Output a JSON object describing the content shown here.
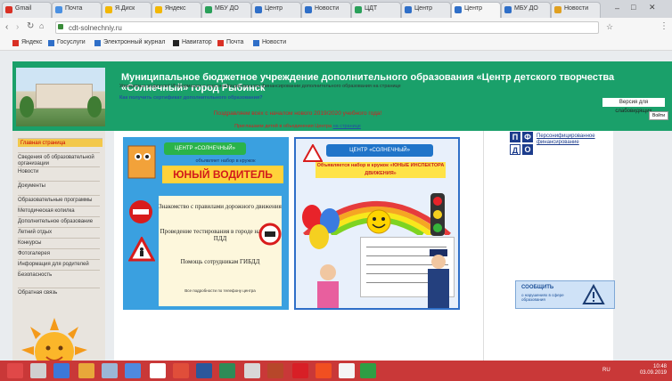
{
  "browser": {
    "tabs": [
      {
        "label": "Gmail",
        "color": "#d93025"
      },
      {
        "label": "Почта",
        "color": "#4a90e2"
      },
      {
        "label": "Я.Диск",
        "color": "#f2b705"
      },
      {
        "label": "Яндекс",
        "color": "#f2b705"
      },
      {
        "label": "МБУ ДО",
        "color": "#2aa05a"
      },
      {
        "label": "Центр",
        "color": "#2f6fc8"
      },
      {
        "label": "Новости",
        "color": "#2f6fc8"
      },
      {
        "label": "ЦДТ",
        "color": "#2aa05a"
      },
      {
        "label": "Центр",
        "color": "#2f6fc8"
      },
      {
        "label": "Центр",
        "color": "#2f6fc8"
      },
      {
        "label": "МБУ ДО",
        "color": "#2f6fc8"
      },
      {
        "label": "Новости",
        "color": "#e0a020"
      }
    ],
    "active_tab": 9,
    "url": "cdt-solnechniy.ru",
    "bookmarks": [
      {
        "label": "Яндекс",
        "color": "#d93025"
      },
      {
        "label": "Госуслуги",
        "color": "#2f6fc8"
      },
      {
        "label": "Электронный журнал",
        "color": "#2f6fc8"
      },
      {
        "label": "Навигатор",
        "color": "#222222"
      },
      {
        "label": "Почта",
        "color": "#d93025"
      },
      {
        "label": "Новости",
        "color": "#2f6fc8"
      }
    ]
  },
  "header": {
    "title_line1": "Муниципальное бюджетное учреждение дополнительного образования «Центр детского творчества",
    "title_line2": "«Солнечный» город Рыбинск",
    "version_button": "Версия для слабовидящих",
    "enter_button": "Войти"
  },
  "sidebar": {
    "items": [
      "Главная страница",
      "Сведения об образовательной организации",
      "Новости",
      "Документы",
      "Образовательные программы",
      "Методическая копилка",
      "Дополнительное образование",
      "Летний отдых",
      "Конкурсы",
      "Фотогалерея",
      "Информация для родителей",
      "Безопасность",
      "Обратная связь"
    ]
  },
  "content": {
    "notice1": "Уважаемые родители! Информация о персонифицированном финансировании дополнительного образования на странице",
    "notice1_link": "на странице",
    "notice2": "Как получить сертификат дополнительного образования?",
    "congrats": "Поздравляем всех с началом нового 2019/2020 учебного года!",
    "subcongrats": "Приглашаем детей в объединения Центра",
    "subcongrats_link": "на странице"
  },
  "poster1": {
    "head": "ЦЕНТР «СОЛНЕЧНЫЙ»",
    "sub": "объявляет набор в кружок",
    "title": "ЮНЫЙ ВОДИТЕЛЬ",
    "text1": "Знакомство с правилами дорожного движения",
    "text2": "Проведение тестирования в городе на знание ПДД",
    "text3": "Помощь сотрудникам ГИБДД",
    "small": "Все подробности по телефону центра"
  },
  "poster2": {
    "head": "ЦЕНТР «СОЛНЕЧНЫЙ»",
    "title": "Объявляется набор в кружок «ЮНЫЕ ИНСПЕКТОРА ДВИЖЕНИЯ»"
  },
  "right": {
    "note_title": "Персонифицированное финансирование",
    "note_badges": [
      "П",
      "Ф",
      "Д",
      "О"
    ],
    "warn_title": "СООБЩИТЬ",
    "warn_sub": "о нарушениях в сфере образования"
  },
  "taskbar": {
    "clock_time": "10:48",
    "clock_date": "03.09.2019",
    "lang": "RU"
  },
  "colors": {
    "header_green": "#1aa06a",
    "taskbar_red": "#c93838",
    "accent_blue": "#2f6fc8"
  }
}
